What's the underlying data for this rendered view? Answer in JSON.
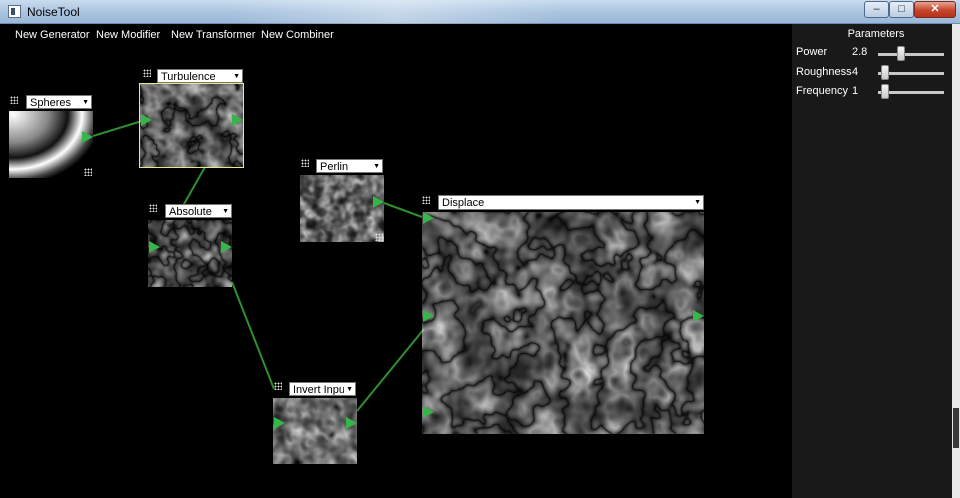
{
  "window": {
    "title": "NoiseTool",
    "buttons": {
      "minimize": "–",
      "maximize": "□",
      "close": "✕"
    }
  },
  "menu": [
    "New Generator",
    "New Modifier",
    "New Transformer",
    "New Combiner"
  ],
  "nodes": {
    "spheres": {
      "type": "Spheres"
    },
    "turbulence": {
      "type": "Turbulence"
    },
    "absolute": {
      "type": "Absolute"
    },
    "perlin": {
      "type": "Perlin"
    },
    "invert": {
      "type": "Invert Input"
    },
    "displace": {
      "type": "Displace"
    }
  },
  "parameters": {
    "title": "Parameters",
    "items": [
      {
        "label": "Power",
        "value": "2.8"
      },
      {
        "label": "Roughness",
        "value": "4"
      },
      {
        "label": "Frequency",
        "value": "1"
      }
    ]
  },
  "colors": {
    "port": "#36b54a",
    "wire": "#2f8f2f",
    "selected_border": "#e8e89a"
  }
}
